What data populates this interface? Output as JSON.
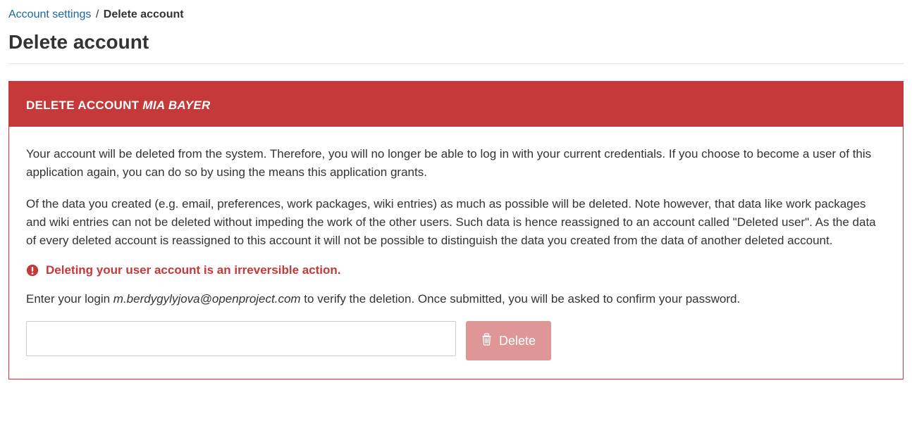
{
  "breadcrumb": {
    "parent": "Account settings",
    "separator": "/",
    "current": "Delete account"
  },
  "page": {
    "title": "Delete account"
  },
  "panel": {
    "header_prefix": "DELETE ACCOUNT ",
    "header_username": "MIA BAYER",
    "para1": "Your account will be deleted from the system. Therefore, you will no longer be able to log in with your current credentials. If you choose to become a user of this application again, you can do so by using the means this application grants.",
    "para2": "Of the data you created (e.g. email, preferences, work packages, wiki entries) as much as possible will be deleted. Note however, that data like work packages and wiki entries can not be deleted without impeding the work of the other users. Such data is hence reassigned to an account called \"Deleted user\". As the data of every deleted account is reassigned to this account it will not be possible to distinguish the data you created from the data of another deleted account.",
    "warning": "Deleting your user account is an irreversible action.",
    "verify_prefix": "Enter your login ",
    "login_email": "m.berdygylyjova@openproject.com",
    "verify_suffix": " to verify the deletion. Once submitted, you will be asked to confirm your password.",
    "delete_button": "Delete"
  }
}
